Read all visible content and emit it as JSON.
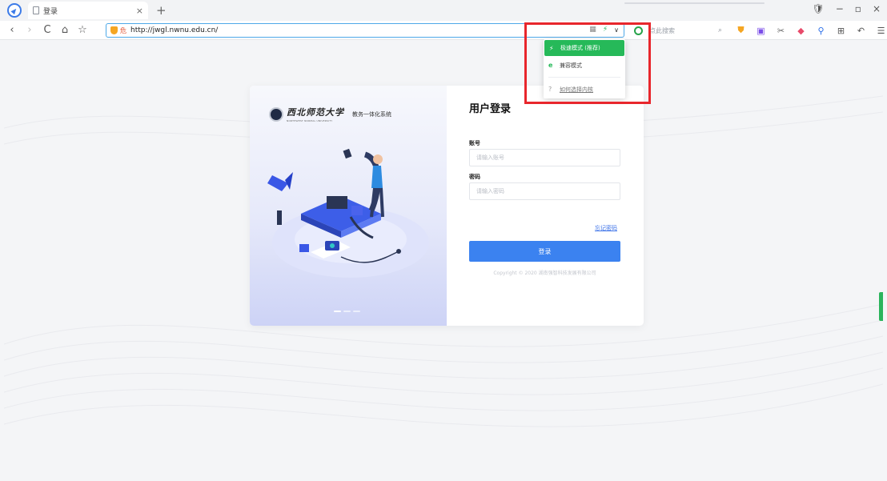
{
  "browser": {
    "tab_title": "登录",
    "tab_close": "×",
    "new_tab": "+",
    "window_controls": [
      "🛡",
      "−",
      "▫",
      "×"
    ]
  },
  "navbar": {
    "back": "‹",
    "forward": "›",
    "reload": "C",
    "home": "⌂",
    "favorite": "☆",
    "security_warning": "危",
    "url": "http://jwgl.nwnu.edu.cn/",
    "search_placeholder": "点此搜索",
    "toolbar_icons": [
      "shield-icon",
      "note-icon",
      "scissors-icon",
      "game-icon",
      "search-icon",
      "grid-icon",
      "undo-icon",
      "menu-icon"
    ]
  },
  "engine_menu": {
    "items": [
      {
        "label": "极速模式 (推荐)",
        "icon": "bolt-icon",
        "active": true
      },
      {
        "label": "兼容模式",
        "icon": "ie-icon",
        "active": false
      },
      {
        "label": "如何选择内核",
        "icon": "question-icon",
        "active": false
      }
    ]
  },
  "login": {
    "university_name": "西北师范大学",
    "university_en": "NORTHWEST NORMAL UNIVERSITY",
    "system_name": "教务一体化系统",
    "title": "用户登录",
    "account_label": "账号",
    "account_placeholder": "请输入账号",
    "password_label": "密码",
    "password_placeholder": "请输入密码",
    "forgot_password": "忘记密码",
    "login_button": "登录",
    "copyright": "Copyright © 2020 湖南强智科技发展有限公司"
  },
  "colors": {
    "accent_blue": "#3b82f0",
    "engine_green": "#26b959",
    "highlight_red": "#e8262c"
  }
}
